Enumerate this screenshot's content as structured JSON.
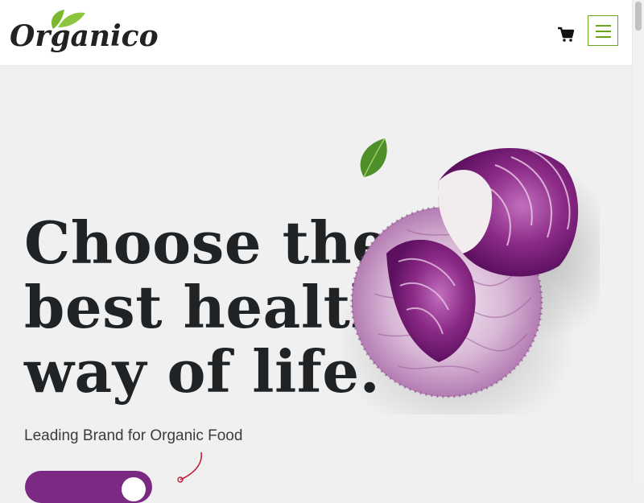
{
  "header": {
    "logo_text": "Organico",
    "cart_icon": "shopping-cart-icon",
    "menu_icon": "hamburger-menu-icon"
  },
  "hero": {
    "title_lines": [
      "Choose the",
      "best healthie",
      "way of life."
    ],
    "subtitle": "Leading Brand for Organic Food",
    "image": "red-cabbage-halves",
    "decor": "basil-leaf"
  },
  "colors": {
    "accent_green": "#6aa31e",
    "cta_purple": "#7b2a84",
    "background": "#f0f0f0",
    "title": "#1f2326"
  }
}
